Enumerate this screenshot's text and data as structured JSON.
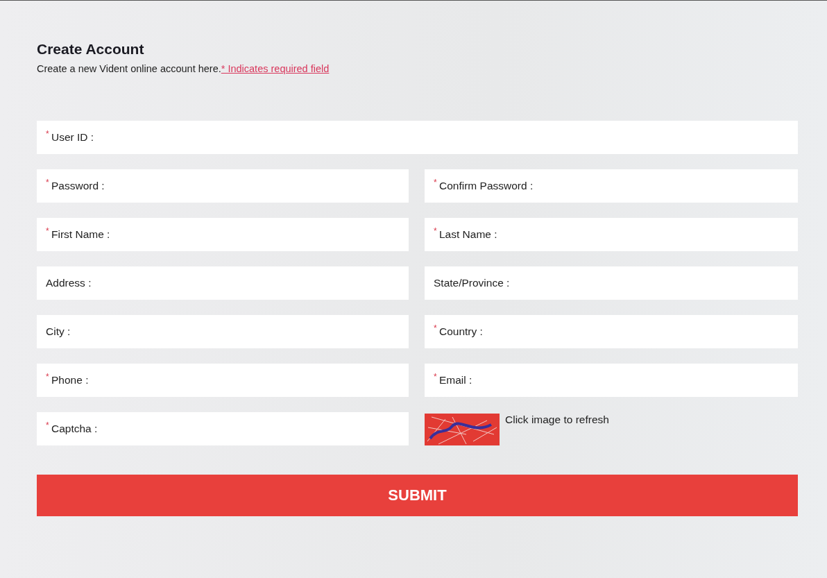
{
  "heading": "Create Account",
  "intro": {
    "text": "Create a new Vident online account here.",
    "link": "* Indicates required field"
  },
  "fields": [
    {
      "required_mark": "*",
      "placeholder": "User ID :"
    },
    {
      "required_mark": "*",
      "placeholder": "Password :"
    },
    {
      "required_mark": "*",
      "placeholder": "Confirm Password :"
    },
    {
      "required_mark": "*",
      "placeholder": "First Name :"
    },
    {
      "required_mark": "*",
      "placeholder": "Last Name :"
    },
    {
      "placeholder": "Address :"
    },
    {
      "placeholder": "State/Province :"
    },
    {
      "placeholder": "City :"
    },
    {
      "required_mark": "*",
      "placeholder": "Country :"
    },
    {
      "required_mark": "*",
      "placeholder": "Phone :"
    },
    {
      "required_mark": "*",
      "placeholder": "Email :"
    },
    {
      "required_mark": "*",
      "placeholder": "Captcha :"
    }
  ],
  "captcha": {
    "hint": "Click image to refresh"
  },
  "submit": "SUBMIT"
}
